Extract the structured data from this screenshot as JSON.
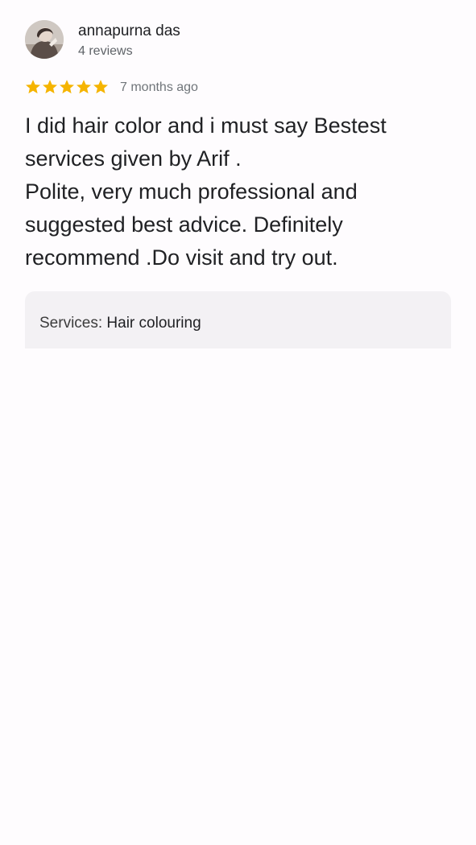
{
  "review": {
    "author": {
      "name": "annapurna das",
      "reviews_count": "4 reviews",
      "avatar_icon": "profile-photo"
    },
    "rating": {
      "stars": 5,
      "max_stars": 5,
      "star_color": "#f5b400",
      "time_ago": "7 months ago"
    },
    "text_lines": [
      "I did hair color and i must say Bestest services given by Arif .",
      "Polite, very much professional and suggested best advice. Definitely recommend .Do visit and try out."
    ],
    "services": {
      "label": "Services:",
      "value": "Hair colouring"
    }
  }
}
